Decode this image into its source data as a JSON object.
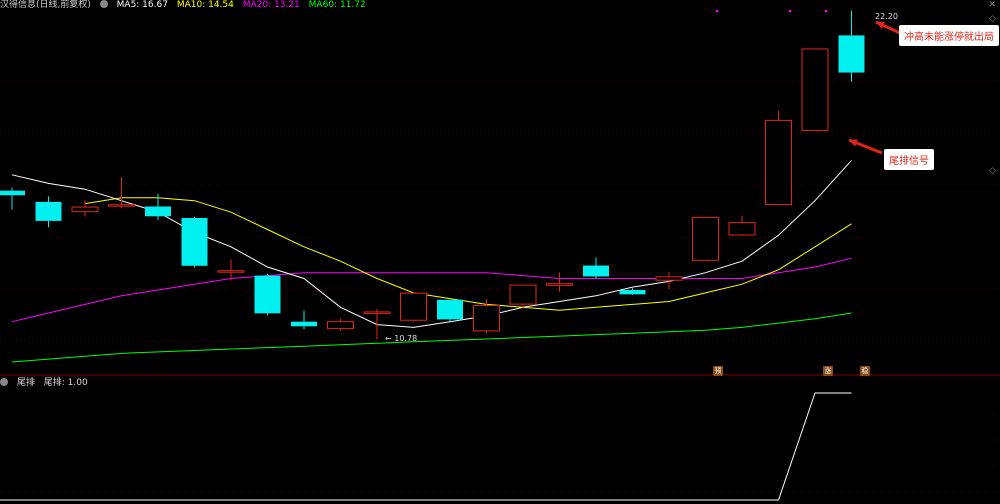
{
  "main_header": {
    "title": "汉得信息(日线,前复权)",
    "ma5": "MA5: 16.67",
    "ma10": "MA10: 14.54",
    "ma20": "MA20: 13.21",
    "ma60": "MA60: 11.72"
  },
  "sub_header": {
    "title": "尾排",
    "value": "尾排: 1.00"
  },
  "annotations": {
    "high_price": "22.20",
    "low_price": "10.78",
    "callout_top": "冲高未能涨停就出局",
    "callout_mid": "尾排信号",
    "mark_yu": "预",
    "mark_zhang": "涨",
    "mark_wen": "稳"
  },
  "colors": {
    "up": "#e0241b",
    "down": "#00f0f0",
    "ma5": "#ffffff",
    "ma10": "#ffff00",
    "ma20": "#ff00ff",
    "ma60": "#00ff00",
    "grid": "#800000"
  },
  "chart_data": {
    "type": "candlestick",
    "title": "汉得信息(日线,前复权)",
    "candles": [
      {
        "open": 15.95,
        "close": 15.79,
        "high": 16.06,
        "low": 15.29
      },
      {
        "open": 15.56,
        "close": 14.9,
        "high": 15.75,
        "low": 14.68
      },
      {
        "open": 15.22,
        "close": 15.38,
        "high": 15.62,
        "low": 15.05
      },
      {
        "open": 15.46,
        "close": 15.46,
        "high": 16.42,
        "low": 15.35
      },
      {
        "open": 15.4,
        "close": 15.06,
        "high": 15.84,
        "low": 14.93
      },
      {
        "open": 15.0,
        "close": 13.34,
        "high": 15.05,
        "low": 13.28
      },
      {
        "open": 13.17,
        "close": 13.17,
        "high": 13.56,
        "low": 12.84
      },
      {
        "open": 13.0,
        "close": 11.69,
        "high": 13.06,
        "low": 11.61
      },
      {
        "open": 11.4,
        "close": 11.24,
        "high": 11.79,
        "low": 11.14
      },
      {
        "open": 11.16,
        "close": 11.4,
        "high": 11.5,
        "low": 11.08
      },
      {
        "open": 11.74,
        "close": 11.74,
        "high": 11.84,
        "low": 10.78
      },
      {
        "open": 11.45,
        "close": 12.39,
        "high": 12.39,
        "low": 11.4
      },
      {
        "open": 12.16,
        "close": 11.48,
        "high": 12.17,
        "low": 11.42
      },
      {
        "open": 11.08,
        "close": 11.96,
        "high": 12.17,
        "low": 10.99
      },
      {
        "open": 12.01,
        "close": 12.67,
        "high": 12.67,
        "low": 11.85
      },
      {
        "open": 12.66,
        "close": 12.72,
        "high": 13.11,
        "low": 12.44
      },
      {
        "open": 13.35,
        "close": 12.97,
        "high": 13.63,
        "low": 12.89
      },
      {
        "open": 12.5,
        "close": 12.35,
        "high": 12.56,
        "low": 12.33
      },
      {
        "open": 12.84,
        "close": 12.96,
        "high": 13.13,
        "low": 12.53
      },
      {
        "open": 13.53,
        "close": 15.02,
        "high": 15.02,
        "low": 13.53
      },
      {
        "open": 14.41,
        "close": 14.84,
        "high": 15.08,
        "low": 14.38
      },
      {
        "open": 15.47,
        "close": 18.39,
        "high": 18.72,
        "low": 15.47
      },
      {
        "open": 18.04,
        "close": 20.87,
        "high": 20.87,
        "low": 18.04
      },
      {
        "open": 21.34,
        "close": 20.05,
        "high": 22.2,
        "low": 19.73
      }
    ],
    "ma5": [
      16.5,
      16.2,
      16.0,
      15.6,
      15.2,
      14.5,
      14.0,
      13.3,
      12.9,
      11.9,
      11.3,
      11.2,
      11.4,
      11.6,
      11.9,
      12.1,
      12.3,
      12.6,
      12.8,
      13.1,
      13.5,
      14.4,
      15.6,
      17.0
    ],
    "ma10": [
      null,
      null,
      15.5,
      15.7,
      15.7,
      15.6,
      15.2,
      14.6,
      14.0,
      13.5,
      12.9,
      12.4,
      12.2,
      12.0,
      11.9,
      11.8,
      11.9,
      12.0,
      12.1,
      12.4,
      12.7,
      13.2,
      14.0,
      14.8
    ],
    "ma20": [
      11.4,
      11.7,
      12.0,
      12.3,
      12.5,
      12.7,
      12.9,
      13.0,
      13.1,
      13.1,
      13.1,
      13.1,
      13.1,
      13.1,
      13.0,
      12.9,
      12.9,
      12.9,
      12.9,
      12.9,
      12.9,
      13.1,
      13.3,
      13.6
    ],
    "ma60": [
      10.0,
      10.1,
      10.2,
      10.3,
      10.35,
      10.4,
      10.45,
      10.5,
      10.55,
      10.6,
      10.65,
      10.7,
      10.75,
      10.8,
      10.85,
      10.9,
      10.95,
      11.0,
      11.05,
      11.1,
      11.2,
      11.35,
      11.5,
      11.7
    ],
    "tail_indicator": [
      0,
      0,
      0,
      0,
      0,
      0,
      0,
      0,
      0,
      0,
      0,
      0,
      0,
      0,
      0,
      0,
      0,
      0,
      0,
      0,
      0,
      0,
      1,
      1
    ]
  }
}
